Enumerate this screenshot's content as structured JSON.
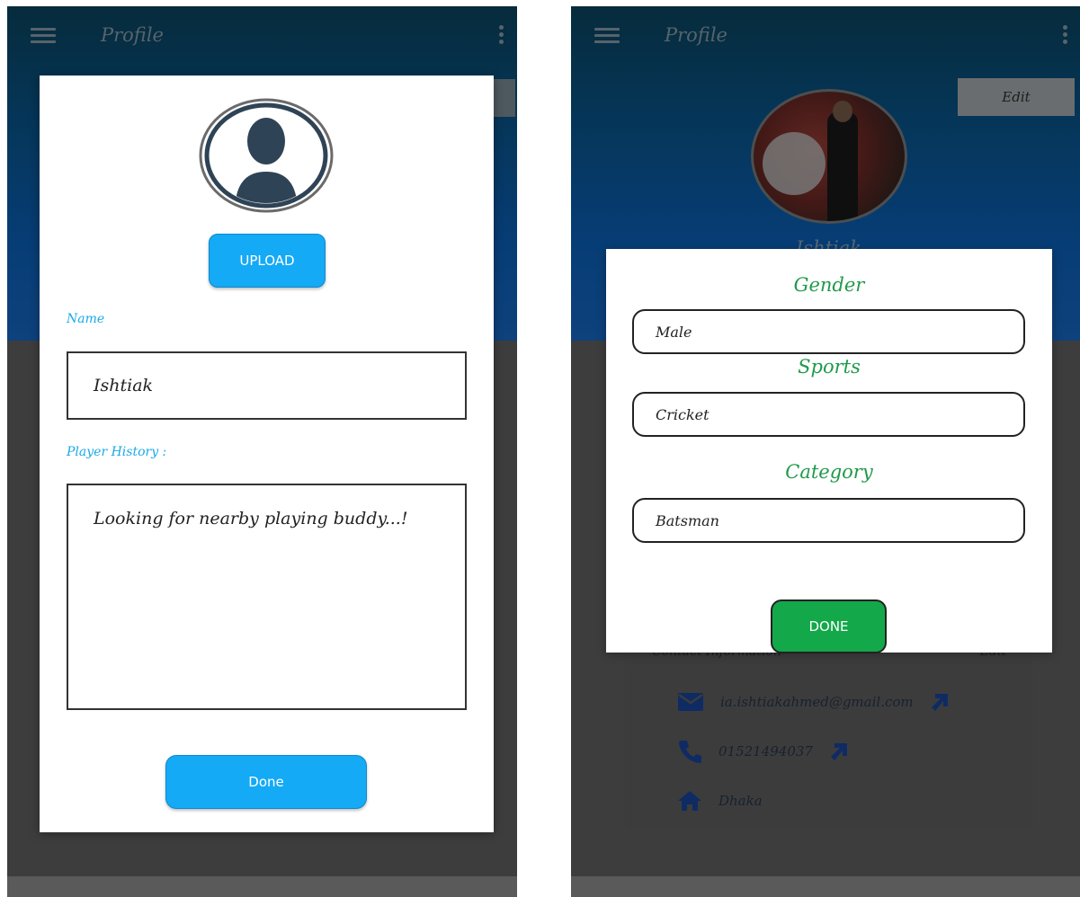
{
  "left_screen": {
    "appbar": {
      "title": "Profile"
    },
    "dialog": {
      "upload_label": "UPLOAD",
      "name_label": "Name",
      "name_value": "Ishtiak",
      "history_label": "Player History :",
      "history_value": "Looking for nearby playing buddy...!",
      "done_label": "Done"
    }
  },
  "right_screen": {
    "appbar": {
      "title": "Profile"
    },
    "edit_label": "Edit",
    "profile_name": "Ishtiak",
    "dialog": {
      "gender_title": "Gender",
      "gender_value": "Male",
      "sports_title": "Sports",
      "sports_value": "Cricket",
      "category_title": "Category",
      "category_value": "Batsman",
      "done_label": "DONE"
    },
    "contact": {
      "heading": "Contact Information",
      "edit_label": "Edit",
      "email": "ia.ishtiakahmed@gmail.com",
      "phone": "01521494037",
      "location": "Dhaka"
    }
  },
  "icons": {
    "menu": "menu-icon",
    "overflow": "kebab-icon",
    "avatar": "person-silhouette-icon",
    "email": "mail-icon",
    "phone": "phone-icon",
    "home": "home-icon",
    "external": "arrow-up-right-icon"
  },
  "colors": {
    "header_dark": "#0b4f6e",
    "header_blue": "#0d6fd6",
    "primary_button": "#14aaf5",
    "label_cyan": "#1aa9e6",
    "section_green": "#1f9a4a",
    "done_green": "#13a84a"
  }
}
